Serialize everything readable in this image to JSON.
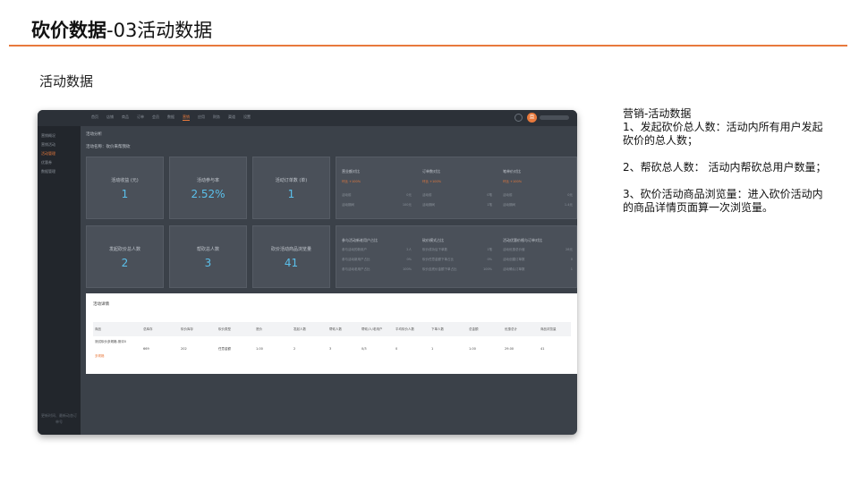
{
  "slide": {
    "title_bold": "砍价数据",
    "title_rest": "-03活动数据",
    "section": "活动数据"
  },
  "app": {
    "nav": [
      "首页",
      "店铺",
      "商品",
      "订单",
      "会员",
      "数据",
      "营销",
      "应用",
      "财务",
      "渠道",
      "设置"
    ],
    "nav_active_index": 6,
    "avatar_text": "旦",
    "sidebar": [
      "营销概况",
      "营销活动",
      "活动管理",
      "优惠券",
      "数据管理"
    ],
    "sidebar_active_index": 2,
    "sidebar_footer": "更新时间、最新动态订单号",
    "heading": "活动分析",
    "subheading": "活动名称：砍价来帮我砍",
    "stats": [
      {
        "label": "活动收益 (元)",
        "value": "1"
      },
      {
        "label": "活动参与率",
        "value": "2.52%"
      },
      {
        "label": "活动订单数 (单)",
        "value": "1"
      },
      {
        "label": "发起砍价总人数",
        "value": "2"
      },
      {
        "label": "帮砍总人数",
        "value": "3"
      },
      {
        "label": "砍价活动商品浏览量",
        "value": "41"
      }
    ],
    "panel_top": [
      {
        "title": "营业额对比",
        "sub": "环比 +100%",
        "rows": [
          {
            "k": "活动前",
            "v": "0元"
          },
          {
            "k": "活动期间",
            "v": "100元"
          }
        ]
      },
      {
        "title": "订单数对比",
        "sub": "环比 +100%",
        "rows": [
          {
            "k": "活动前",
            "v": "0笔"
          },
          {
            "k": "活动期间",
            "v": "1笔"
          }
        ]
      },
      {
        "title": "笔单价对比",
        "sub": "环比 +100%",
        "rows": [
          {
            "k": "活动前",
            "v": "0元"
          },
          {
            "k": "活动期间",
            "v": "1.4元"
          }
        ]
      }
    ],
    "panel_bottom": [
      {
        "title": "参与活动新老用户占比",
        "rows": [
          {
            "k": "参与活动的新用户",
            "v": "2人"
          },
          {
            "k": "参与活动新用户占比",
            "v": "0%"
          },
          {
            "k": "参与活动老用户占比",
            "v": "100%"
          }
        ]
      },
      {
        "title": "砍价模式占比",
        "rows": [
          {
            "k": "砍价成功后下单数",
            "v": "1笔"
          },
          {
            "k": "砍价任意金额下单占比",
            "v": "0%"
          },
          {
            "k": "砍价至底价金额下单占比",
            "v": "100%"
          }
        ]
      },
      {
        "title": "活动优惠价格与订单对比",
        "rows": [
          {
            "k": "活动优惠总价值",
            "v": "28元"
          },
          {
            "k": "活动创建订单数",
            "v": "0"
          },
          {
            "k": "活动确认订单数",
            "v": "1"
          }
        ]
      }
    ],
    "detail": {
      "title": "活动详情",
      "columns": [
        "商品",
        "总库存",
        "砍价库存",
        "砍价类型",
        "底价",
        "发起人数",
        "帮砍人数",
        "帮砍/人/老用户",
        "平均砍价人数",
        "下单人数",
        "总金额",
        "优惠总计",
        "商品浏览量"
      ],
      "row": [
        "测试砍价多规格-测评0",
        "669",
        "202",
        "任意金额",
        "1.00",
        "2",
        "3",
        "0/3",
        "0",
        "1",
        "1.00",
        "29.00",
        "41"
      ],
      "row_link": "多规格"
    }
  },
  "notes": {
    "heading": "营销-活动数据",
    "item1": "1、发起砍价总人数：活动内所有用户发起砍价的总人数；",
    "item2": "2、帮砍总人数：  活动内帮砍总用户数量；",
    "item3": "3、砍价活动商品浏览量：进入砍价活动内的商品详情页面算一次浏览量。"
  }
}
